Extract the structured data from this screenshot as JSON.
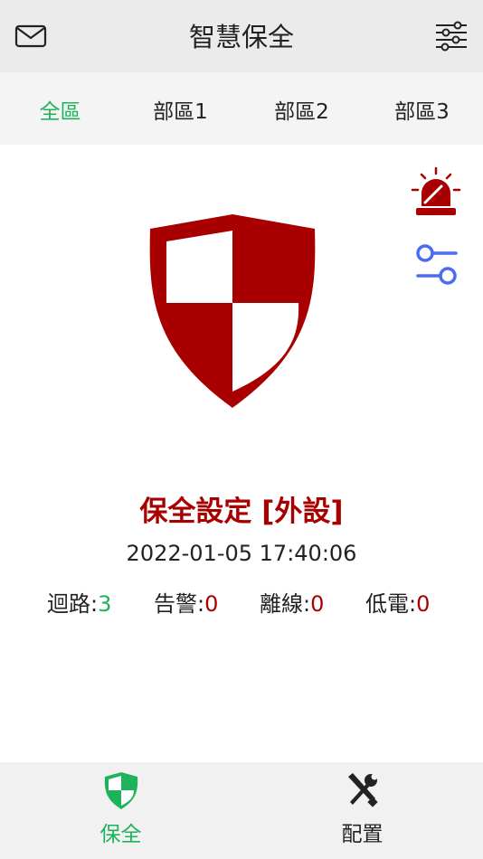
{
  "header": {
    "title": "智慧保全",
    "left_icon": "mail-icon",
    "right_icon": "filter-icon"
  },
  "tabs": [
    {
      "label": "全區",
      "active": true
    },
    {
      "label": "部區1",
      "active": false
    },
    {
      "label": "部區2",
      "active": false
    },
    {
      "label": "部區3",
      "active": false
    }
  ],
  "side_actions": {
    "alarm_icon": "alarm-siren-icon",
    "settings_icon": "toggle-settings-icon"
  },
  "status": {
    "mode": "保全設定 [外設]",
    "datetime": "2022-01-05 17:40:06",
    "stats": [
      {
        "label": "迴路:",
        "value": "3",
        "color": "green"
      },
      {
        "label": "告警:",
        "value": "0",
        "color": "red"
      },
      {
        "label": "離線:",
        "value": "0",
        "color": "red"
      },
      {
        "label": "低電:",
        "value": "0",
        "color": "red"
      }
    ]
  },
  "bottom_nav": [
    {
      "label": "保全",
      "icon": "shield-icon",
      "active": true
    },
    {
      "label": "配置",
      "icon": "tools-icon",
      "active": false
    }
  ],
  "colors": {
    "accent_green": "#1eb35a",
    "alarm_red": "#a80000",
    "shield_red": "#a80000",
    "settings_blue": "#4a6cf0"
  }
}
